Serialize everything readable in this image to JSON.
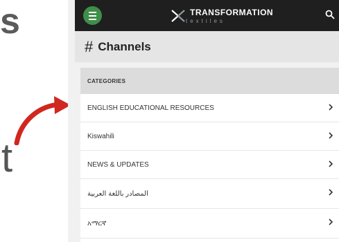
{
  "slide": {
    "fragment_top": "s",
    "fragment_bottom": "t"
  },
  "colors": {
    "arrow": "#d0271f",
    "menu_button": "#3f8e4a",
    "app_bar": "#1f1f1f"
  },
  "app": {
    "logo_line1": "TRANSFORMATION",
    "logo_line2": "textiles",
    "menu_icon": "hamburger-icon",
    "search_icon": "search-icon"
  },
  "page": {
    "title": "Channels",
    "title_icon": "#"
  },
  "categories": {
    "header": "CATEGORIES",
    "items": [
      {
        "label": "ENGLISH EDUCATIONAL RESOURCES"
      },
      {
        "label": "Kiswahili"
      },
      {
        "label": "NEWS & UPDATES"
      },
      {
        "label": "المصادر باللغة العربية"
      },
      {
        "label": "አማርኛ"
      }
    ]
  }
}
